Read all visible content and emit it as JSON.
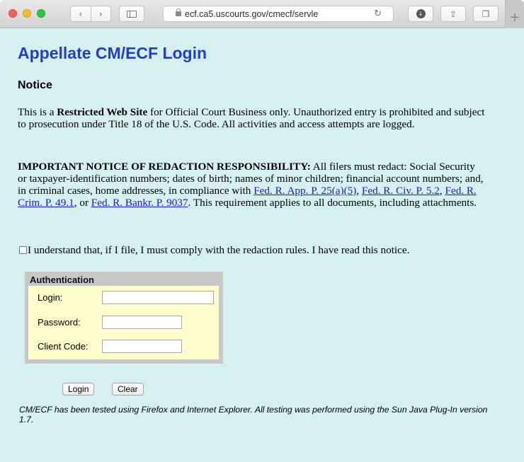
{
  "browser": {
    "url": "ecf.ca5.uscourts.gov/cmecf/servle",
    "back_glyph": "‹",
    "forward_glyph": "›",
    "reload_glyph": "↻",
    "newtab_glyph": "+",
    "share_glyph": "⇪",
    "tabs_glyph": "❐",
    "download_glyph": "↓",
    "traffic_colors": [
      "#fc5f57",
      "#fdbc2e",
      "#28c840"
    ]
  },
  "page": {
    "title": "Appellate CM/ECF Login",
    "title_color": "#1e3fce",
    "background": "#d6f0ef",
    "notice_heading": "Notice",
    "p1": {
      "lead": "This is a ",
      "bold": "Restricted Web Site",
      "rest": " for Official Court Business only. Unauthorized entry is prohibited and subject to prosecution under Title 18 of the U.S. Code. All activities and access attempts are logged."
    },
    "p2": {
      "bold": "IMPORTANT NOTICE OF REDACTION RESPONSIBILITY:",
      "text1": " All filers must redact: Social Security or taxpayer-identification numbers; dates of birth; names of minor children; financial account numbers; and, in criminal cases, home addresses, in compliance with ",
      "link1": "Fed. R. App. P. 25(a)(5)",
      "sep1": ", ",
      "link2": "Fed. R. Civ. P. 5.2",
      "sep2": ", ",
      "link3": "Fed. R. Crim. P. 49.1",
      "sep3": ", or ",
      "link4": "Fed. R. Bankr. P. 9037",
      "text2": ". This requirement applies to all documents, including attachments."
    },
    "acknowledge_label": "I understand that, if I file, I must comply with the redaction rules. I have read this notice.",
    "acknowledge_checked": false
  },
  "auth": {
    "title": "Authentication",
    "login_label": "Login:",
    "login_value": "",
    "password_label": "Password:",
    "password_value": "",
    "client_label": "Client Code:",
    "client_value": "",
    "panel_color": "#c8c8c8",
    "body_color": "#ffffcc"
  },
  "buttons": {
    "login": "Login",
    "clear": "Clear"
  },
  "footnote": "CM/ECF has been tested using Firefox and Internet Explorer. All testing was performed using the Sun Java Plug-In version 1.7."
}
